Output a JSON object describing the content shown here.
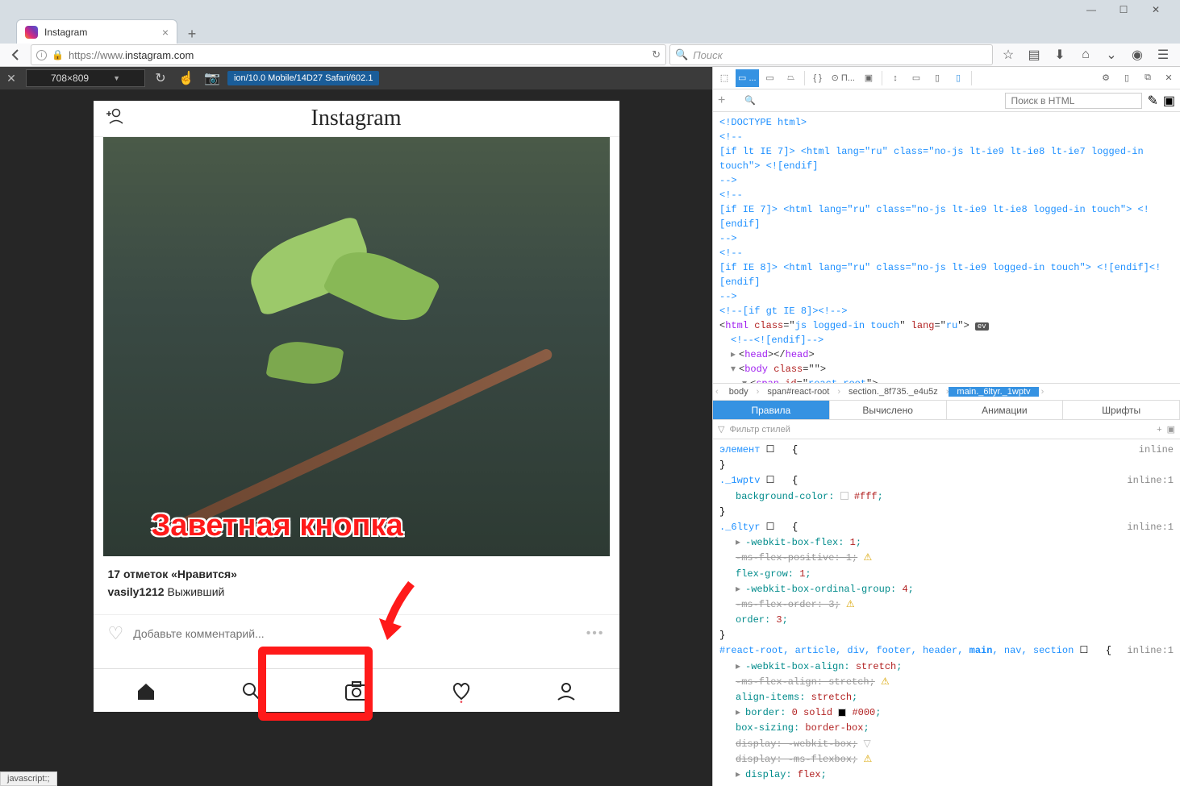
{
  "window": {
    "minimize": "—",
    "maximize": "☐",
    "close": "✕"
  },
  "tab": {
    "title": "Instagram",
    "close": "×",
    "new": "+"
  },
  "addressbar": {
    "url_prefix": "https://www.",
    "url_domain": "instagram.com",
    "search_placeholder": "Поиск"
  },
  "responsive": {
    "dimensions": "708×809",
    "ua": "ion/10.0 Mobile/14D27 Safari/602.1"
  },
  "instagram": {
    "logo": "Instagram",
    "overlay_text": "Заветная кнопка",
    "likes": "17 отметок «Нравится»",
    "username": "vasily1212",
    "caption": "Выживший",
    "comment_placeholder": "Добавьте комментарий..."
  },
  "devtools": {
    "search_placeholder": "Поиск в HTML",
    "html_lines": [
      {
        "indent": 0,
        "html": "<!DOCTYPE html>"
      },
      {
        "indent": 0,
        "html": "<!--"
      },
      {
        "indent": 0,
        "html": "[if lt IE 7]> <html lang=\"ru\" class=\"no-js lt-ie9 lt-ie8 lt-ie7 logged-in touch\"> <![endif]"
      },
      {
        "indent": 0,
        "html": "-->"
      },
      {
        "indent": 0,
        "html": "<!--"
      },
      {
        "indent": 0,
        "html": "[if IE 7]> <html lang=\"ru\" class=\"no-js lt-ie9 lt-ie8 logged-in touch\"> <![endif]"
      },
      {
        "indent": 0,
        "html": "-->"
      },
      {
        "indent": 0,
        "html": "<!--"
      },
      {
        "indent": 0,
        "html": "[if IE 8]> <html lang=\"ru\" class=\"no-js lt-ie9 logged-in touch\"> <![endif]<![endif]"
      },
      {
        "indent": 0,
        "html": "-->"
      },
      {
        "indent": 0,
        "html": "<!--[if gt IE 8]><!-->"
      }
    ],
    "breadcrumbs": [
      "body",
      "span#react-root",
      "section._8f735._e4u5z",
      "main._6ltyr._1wptv"
    ],
    "tabs": [
      "Правила",
      "Вычислено",
      "Анимации",
      "Шрифты"
    ],
    "filter_placeholder": "Фильтр стилей",
    "css": {
      "element_label": "элемент",
      "inline": "inline",
      "inline1": "inline:1",
      "rules": [
        {
          "sel": "._1wptv",
          "props": [
            {
              "n": "background-color",
              "v": "#fff",
              "swatch": "#fff"
            }
          ]
        },
        {
          "sel": "._6ltyr",
          "props": [
            {
              "n": "-webkit-box-flex",
              "v": "1",
              "tri": true
            },
            {
              "n": "-ms-flex-positive",
              "v": "1",
              "strike": true,
              "warn": true
            },
            {
              "n": "flex-grow",
              "v": "1"
            },
            {
              "n": "-webkit-box-ordinal-group",
              "v": "4",
              "tri": true
            },
            {
              "n": "-ms-flex-order",
              "v": "3",
              "strike": true,
              "warn": true
            },
            {
              "n": "order",
              "v": "3"
            }
          ]
        },
        {
          "sel": "#react-root, article, div, footer, header, main, nav, section",
          "props": [
            {
              "n": "-webkit-box-align",
              "v": "stretch",
              "tri": true
            },
            {
              "n": "-ms-flex-align",
              "v": "stretch",
              "strike": true,
              "warn": true
            },
            {
              "n": "align-items",
              "v": "stretch"
            },
            {
              "n": "border",
              "v": "0 solid #000",
              "tri": true,
              "swatch": "#000"
            },
            {
              "n": "box-sizing",
              "v": "border-box"
            },
            {
              "n": "display",
              "v": "-webkit-box",
              "strike": true,
              "warn": true
            },
            {
              "n": "display",
              "v": "-ms-flexbox",
              "strike": true,
              "warn": true
            },
            {
              "n": "display",
              "v": "flex",
              "tri": true
            }
          ]
        }
      ]
    }
  },
  "statusbar": "javascript:;"
}
